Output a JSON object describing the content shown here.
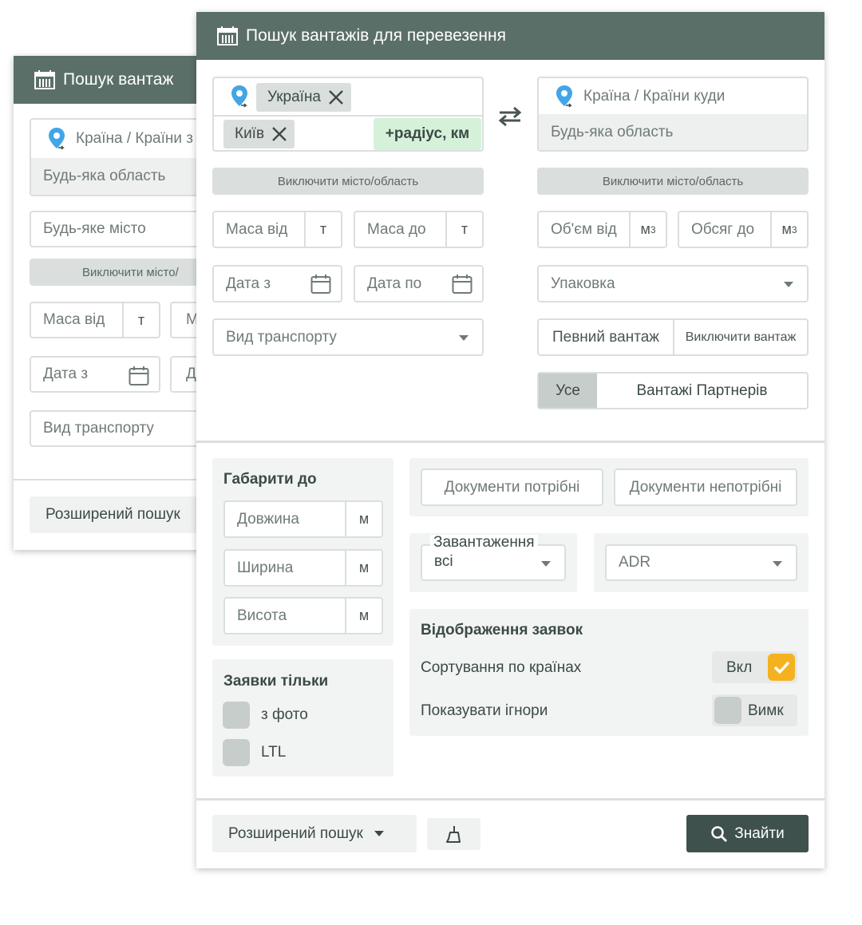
{
  "back_window": {
    "title": "Пошук вантаж",
    "from_country_placeholder": "Країна / Країни з",
    "any_region": "Будь-яка область",
    "any_city": "Будь-яке місто",
    "exclude_label": "Виключити місто/",
    "weight_from": "Маса від",
    "weight_unit": "т",
    "weight_to_partial": "М",
    "date_from": "Дата з",
    "date_to_partial": "Д",
    "transport_type": "Вид транспорту",
    "advanced_search": "Розширений пошук"
  },
  "main": {
    "title": "Пошук вантажів для перевезення",
    "from": {
      "country_chip": "Україна",
      "city_chip": "Київ",
      "radius_button": "+радіус, км",
      "exclude_button": "Виключити місто/область"
    },
    "to": {
      "country_placeholder": "Країна / Країни куди",
      "region_placeholder": "Будь-яка область",
      "exclude_button": "Виключити місто/область"
    },
    "weight_from": "Маса від",
    "weight_to": "Маса до",
    "weight_unit": "т",
    "date_from": "Дата з",
    "date_to": "Дата по",
    "transport_type": "Вид транспорту",
    "volume_from": "Об'єм від",
    "volume_to": "Обсяг до",
    "volume_unit": "м",
    "volume_unit_sup": "3",
    "packaging": "Упаковка",
    "specific_cargo": "Певний вантаж",
    "exclude_cargo": "Виключити вантаж",
    "filter_all": "Усе",
    "filter_partners": "Вантажі Партнерів",
    "dimensions": {
      "title": "Габарити до",
      "length": "Довжина",
      "width": "Ширина",
      "height": "Висота",
      "unit": "м"
    },
    "only_requests": {
      "title": "Заявки тільки",
      "with_photo": "з фото",
      "ltl": "LTL"
    },
    "docs_required": "Документи потрібні",
    "docs_not_required": "Документи непотрібні",
    "loading_label": "Завантаження",
    "loading_value": "всі",
    "adr": "ADR",
    "display": {
      "title": "Відображення заявок",
      "sort_by_country": "Сортування по країнах",
      "sort_state": "Вкл",
      "show_ignored": "Показувати ігнори",
      "ignored_state": "Вимк"
    },
    "advanced_search": "Розширений пошук",
    "find_button": "Знайти"
  },
  "colors": {
    "header": "#5b6f69",
    "primary_button": "#3f514d",
    "radius_button": "#d6f1da",
    "checkbox_on": "#f5b21f",
    "field_border": "#dadfde"
  }
}
